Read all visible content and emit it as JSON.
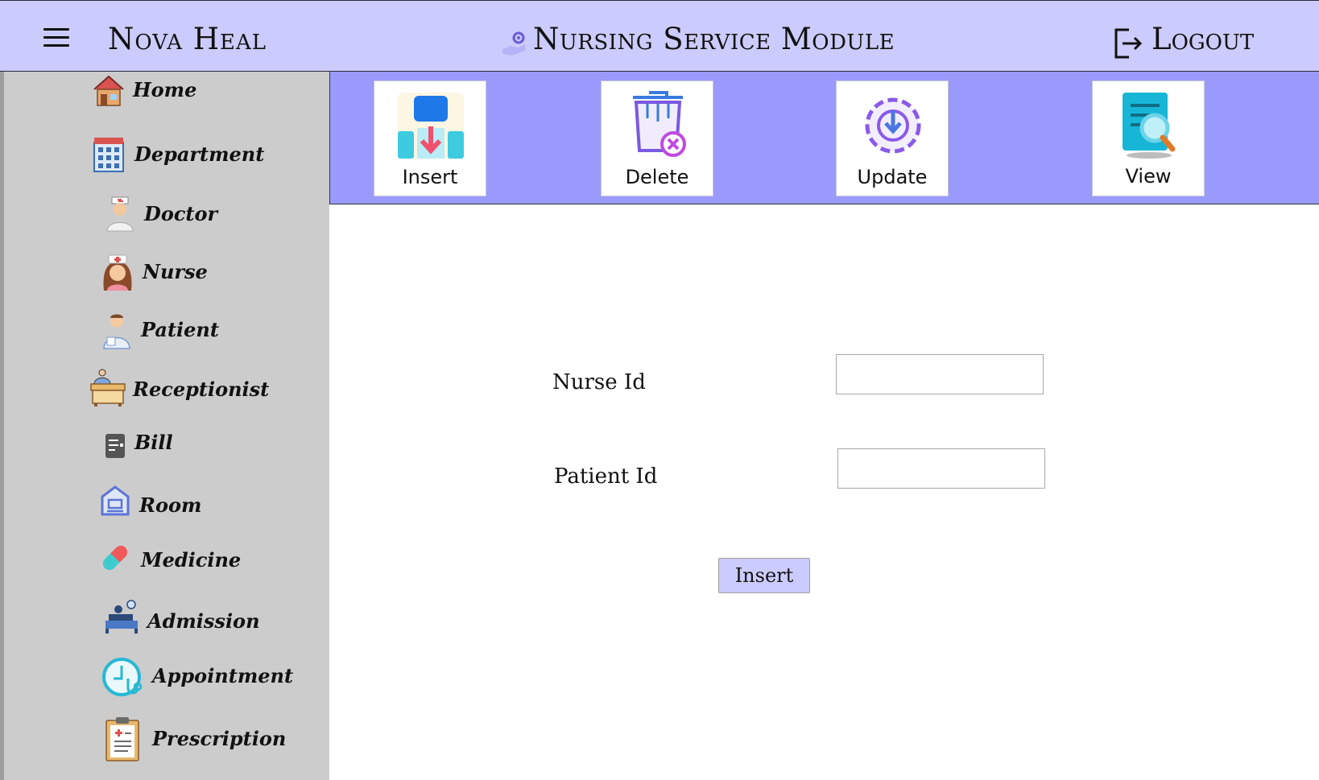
{
  "header": {
    "app_title": "Nova Heal",
    "module_title": "Nursing Service Module",
    "logout_label": "Logout",
    "background": "#cccbfd"
  },
  "sidebar": {
    "background": "#cccccc",
    "items": [
      {
        "label": "Home",
        "icon": "home-icon"
      },
      {
        "label": "Department",
        "icon": "department-building-icon"
      },
      {
        "label": "Doctor",
        "icon": "doctor-icon"
      },
      {
        "label": "Nurse",
        "icon": "nurse-icon"
      },
      {
        "label": "Patient",
        "icon": "patient-icon"
      },
      {
        "label": "Receptionist",
        "icon": "receptionist-desk-icon"
      },
      {
        "label": "Bill",
        "icon": "bill-icon"
      },
      {
        "label": "Room",
        "icon": "room-icon"
      },
      {
        "label": "Medicine",
        "icon": "medicine-capsule-icon"
      },
      {
        "label": "Admission",
        "icon": "admission-bed-icon"
      },
      {
        "label": "Appointment",
        "icon": "appointment-clock-icon"
      },
      {
        "label": "Prescription",
        "icon": "prescription-clipboard-icon"
      }
    ]
  },
  "toolbar": {
    "background": "#9a9afc",
    "buttons": [
      {
        "label": "Insert",
        "icon": "insert-icon"
      },
      {
        "label": "Delete",
        "icon": "delete-trash-icon"
      },
      {
        "label": "Update",
        "icon": "update-gear-icon"
      },
      {
        "label": "View",
        "icon": "view-document-icon"
      }
    ]
  },
  "form": {
    "nurse_id_label": "Nurse Id",
    "nurse_id_value": "",
    "patient_id_label": "Patient Id",
    "patient_id_value": "",
    "submit_label": "Insert"
  }
}
